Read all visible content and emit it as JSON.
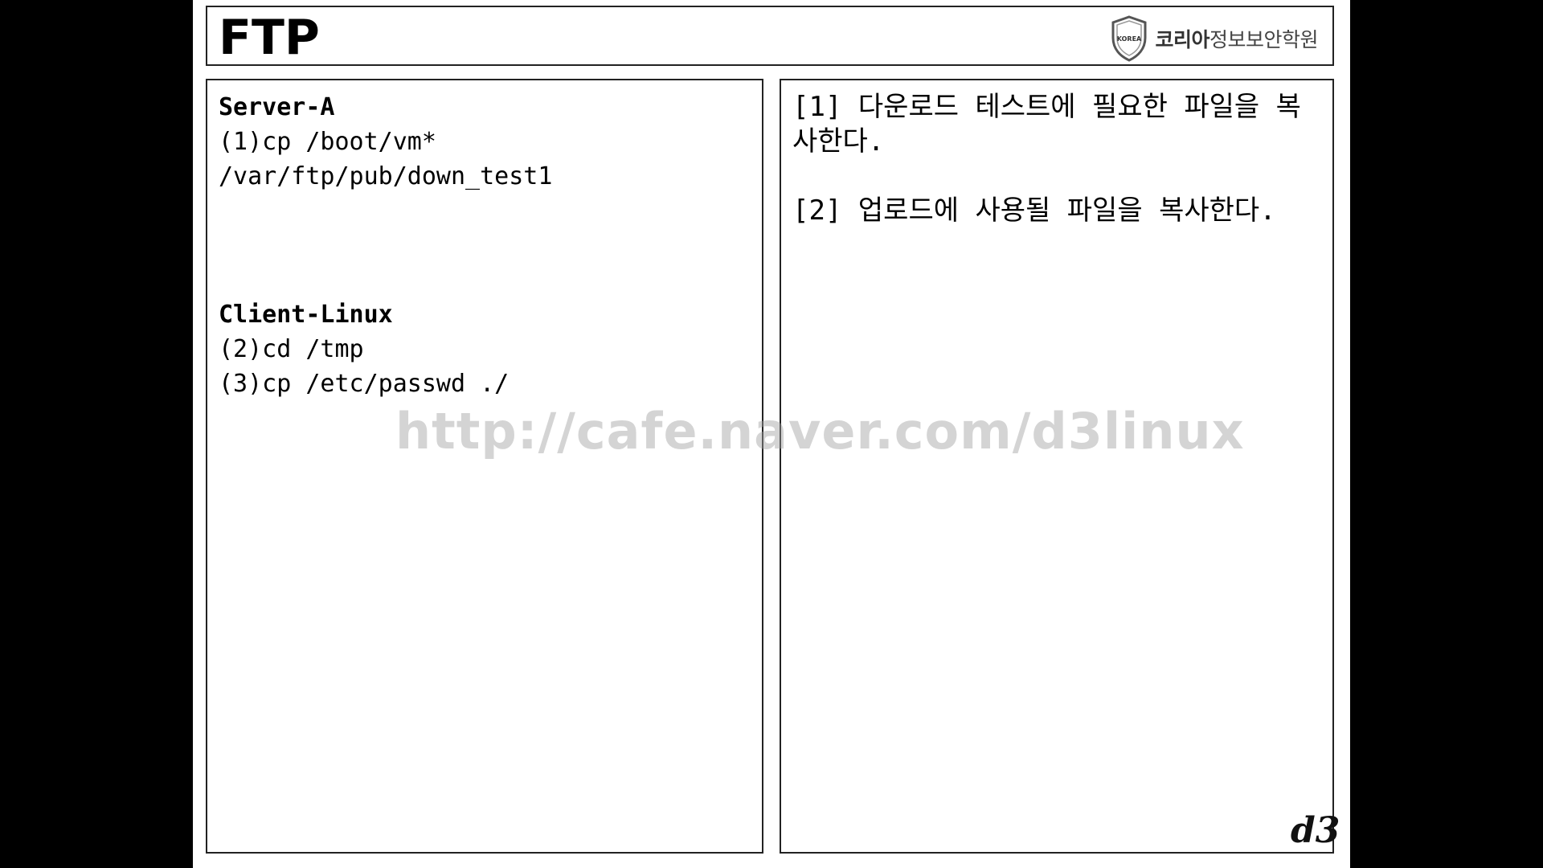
{
  "slide": {
    "title": "FTP",
    "logo": {
      "badge_text": "KOREA",
      "name_bold": "코리아",
      "name_rest": "정보보안학원"
    },
    "left_panel": {
      "server_heading": "Server-A",
      "server_lines": [
        "(1)cp /boot/vm*",
        "/var/ftp/pub/down_test1"
      ],
      "client_heading": "Client-Linux",
      "client_lines": [
        "(2)cd /tmp",
        "(3)cp /etc/passwd ./"
      ]
    },
    "right_panel": {
      "notes": [
        "[1] 다운로드 테스트에 필요한 파일을 복사한다.",
        "[2] 업로드에 사용될 파일을 복사한다."
      ]
    },
    "watermark": "http://cafe.naver.com/d3linux",
    "corner_mark": "d3"
  }
}
